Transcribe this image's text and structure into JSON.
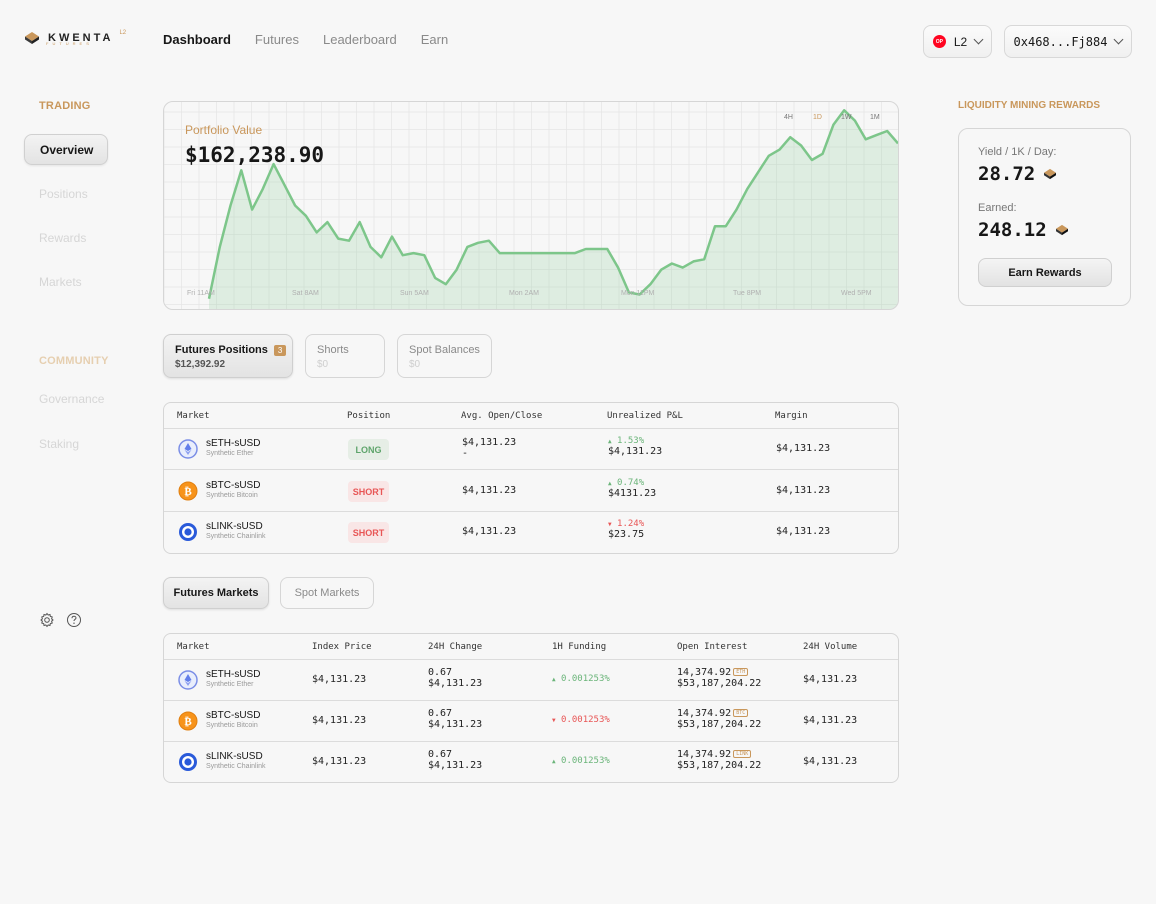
{
  "header": {
    "logo_text": "KWENTA",
    "logo_badge": "L2",
    "logo_sub": "FUTURES",
    "nav": [
      "Dashboard",
      "Futures",
      "Leaderboard",
      "Earn"
    ],
    "network_badge": "OP",
    "network_label": "L2",
    "wallet_label": "0x468...Fj884"
  },
  "sidebar": {
    "trading_heading": "TRADING",
    "trading_items": [
      "Overview",
      "Positions",
      "Rewards",
      "Markets"
    ],
    "community_heading": "COMMUNITY",
    "community_items": [
      "Governance",
      "Staking"
    ]
  },
  "portfolio": {
    "label": "Portfolio Value",
    "value": "$162,238.90",
    "timeframes": [
      "4H",
      "1D",
      "1W",
      "1M"
    ],
    "active_timeframe": "1D",
    "x_ticks": [
      "Fri 11AM",
      "Sat 8AM",
      "Sun 5AM",
      "Mon 2AM",
      "Mon 11PM",
      "Tue 8PM",
      "Wed 5PM"
    ]
  },
  "chart_data": {
    "type": "area",
    "color": "#7dc68a",
    "grid": true,
    "y_scale_note": "unlabeled",
    "values": [
      0.05,
      0.3,
      0.5,
      0.67,
      0.48,
      0.58,
      0.7,
      0.6,
      0.5,
      0.45,
      0.37,
      0.42,
      0.34,
      0.33,
      0.42,
      0.3,
      0.25,
      0.35,
      0.26,
      0.27,
      0.26,
      0.15,
      0.12,
      0.19,
      0.3,
      0.32,
      0.33,
      0.27,
      0.27,
      0.27,
      0.27,
      0.27,
      0.27,
      0.27,
      0.27,
      0.29,
      0.29,
      0.29,
      0.2,
      0.08,
      0.07,
      0.12,
      0.19,
      0.22,
      0.2,
      0.23,
      0.24,
      0.4,
      0.4,
      0.48,
      0.58,
      0.66,
      0.74,
      0.77,
      0.83,
      0.79,
      0.72,
      0.75,
      0.89,
      0.96,
      0.91,
      0.82,
      0.84,
      0.86,
      0.8
    ]
  },
  "rewards": {
    "title": "LIQUIDITY MINING REWARDS",
    "yield_label": "Yield / 1K / Day:",
    "yield_value": "28.72",
    "earned_label": "Earned:",
    "earned_value": "248.12",
    "button": "Earn Rewards"
  },
  "position_tabs": [
    {
      "title": "Futures Positions",
      "badge": "3",
      "value": "$12,392.92"
    },
    {
      "title": "Shorts",
      "value": "$0"
    },
    {
      "title": "Spot Balances",
      "value": "$0"
    }
  ],
  "positions_table": {
    "headers": [
      "Market",
      "Position",
      "Avg. Open/Close",
      "Unrealized P&L",
      "Margin"
    ],
    "rows": [
      {
        "name": "sETH-sUSD",
        "sub": "Synthetic Ether",
        "position": "LONG",
        "avg": "$4,131.23",
        "avg2": "-",
        "pnl_pct": "1.53%",
        "pnl_dir": "up",
        "pnl_val": "$4,131.23",
        "margin": "$4,131.23"
      },
      {
        "name": "sBTC-sUSD",
        "sub": "Synthetic Bitcoin",
        "position": "SHORT",
        "avg": "$4,131.23",
        "avg2": "",
        "pnl_pct": "0.74%",
        "pnl_dir": "up",
        "pnl_val": "$4131.23",
        "margin": "$4,131.23"
      },
      {
        "name": "sLINK-sUSD",
        "sub": "Synthetic Chainlink",
        "position": "SHORT",
        "avg": "$4,131.23",
        "avg2": "",
        "pnl_pct": "1.24%",
        "pnl_dir": "down",
        "pnl_val": "$23.75",
        "margin": "$4,131.23"
      }
    ]
  },
  "market_tabs": [
    "Futures Markets",
    "Spot Markets"
  ],
  "markets_table": {
    "headers": [
      "Market",
      "Index Price",
      "24H Change",
      "1H Funding",
      "Open Interest",
      "24H Volume"
    ],
    "rows": [
      {
        "name": "sETH-sUSD",
        "sub": "Synthetic Ether",
        "index": "$4,131.23",
        "chg": "0.67",
        "chg2": "$4,131.23",
        "funding": "0.001253%",
        "funding_dir": "up",
        "oi": "14,374.92",
        "oi_tag": "ETH",
        "oi2": "$53,187,204.22",
        "vol": "$4,131.23"
      },
      {
        "name": "sBTC-sUSD",
        "sub": "Synthetic Bitcoin",
        "index": "$4,131.23",
        "chg": "0.67",
        "chg2": "$4,131.23",
        "funding": "0.001253%",
        "funding_dir": "down",
        "oi": "14,374.92",
        "oi_tag": "BTC",
        "oi2": "$53,187,204.22",
        "vol": "$4,131.23"
      },
      {
        "name": "sLINK-sUSD",
        "sub": "Synthetic Chainlink",
        "index": "$4,131.23",
        "chg": "0.67",
        "chg2": "$4,131.23",
        "funding": "0.001253%",
        "funding_dir": "up",
        "oi": "14,374.92",
        "oi_tag": "LINK",
        "oi2": "$53,187,204.22",
        "vol": "$4,131.23"
      }
    ]
  },
  "icons": {
    "eth": "eth-icon",
    "btc": "btc-icon",
    "link": "link-icon",
    "settings": "gear-icon",
    "help": "question-icon"
  }
}
